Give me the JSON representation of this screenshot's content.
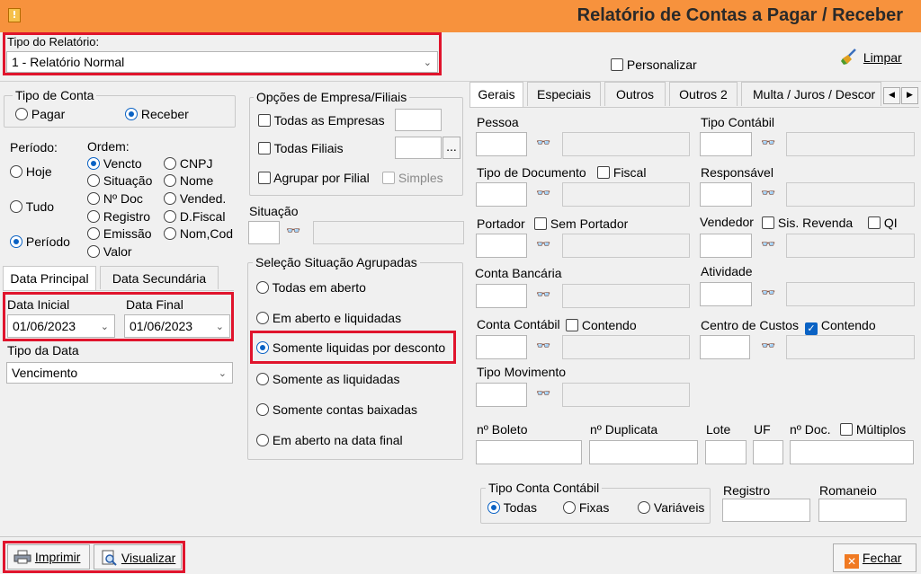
{
  "window": {
    "title": "Relatório de Contas a Pagar / Receber",
    "icon": "warning-app-icon"
  },
  "report_type": {
    "label": "Tipo do Relatório:",
    "value": "1 - Relatório Normal"
  },
  "personalizar": {
    "label": "Personalizar",
    "checked": false
  },
  "limpar": {
    "label": "Limpar",
    "icon": "broom-icon"
  },
  "tipo_conta": {
    "title": "Tipo de Conta",
    "options": [
      "Pagar",
      "Receber"
    ],
    "selected": "Receber"
  },
  "periodo": {
    "title": "Período:",
    "options": [
      "Hoje",
      "Tudo",
      "Período"
    ],
    "selected": "Período"
  },
  "ordem": {
    "title": "Ordem:",
    "options": [
      "Vencto",
      "CNPJ",
      "Situação",
      "Nome",
      "Nº Doc",
      "Vended.",
      "Registro",
      "D.Fiscal",
      "Emissão",
      "Nom,Cod",
      "Valor"
    ],
    "selected": "Vencto"
  },
  "date_tabs": [
    "Data Principal",
    "Data Secundária"
  ],
  "data_inicial": {
    "label": "Data Inicial",
    "value": "01/06/2023"
  },
  "data_final": {
    "label": "Data Final",
    "value": "01/06/2023"
  },
  "tipo_data": {
    "label": "Tipo da Data",
    "value": "Vencimento"
  },
  "empresa": {
    "title": "Opções de Empresa/Filiais",
    "todas_empresas": "Todas as Empresas",
    "todas_filiais": "Todas Filiais",
    "agrupar": "Agrupar por Filial",
    "simples": "Simples",
    "ellipsis": "..."
  },
  "situacao": {
    "label": "Situação"
  },
  "selecao": {
    "title": "Seleção Situação Agrupadas",
    "options": [
      "Todas em aberto",
      "Em aberto e liquidadas",
      "Somente liquidas por desconto",
      "Somente as liquidadas",
      "Somente contas baixadas",
      "Em aberto na data final"
    ],
    "selected": "Somente liquidas por desconto"
  },
  "right_tabs": [
    "Gerais",
    "Especiais",
    "Outros",
    "Outros 2",
    "Multa / Juros / Descor"
  ],
  "fields": {
    "pessoa": "Pessoa",
    "tipo_contabil": "Tipo Contábil",
    "tipo_documento": "Tipo de Documento",
    "fiscal": "Fiscal",
    "responsavel": "Responsável",
    "portador": "Portador",
    "sem_portador": "Sem Portador",
    "vendedor": "Vendedor",
    "sis_revenda": "Sis. Revenda",
    "qi": "QI",
    "conta_bancaria": "Conta Bancária",
    "atividade": "Atividade",
    "conta_contabil": "Conta Contábil",
    "contendo": "Contendo",
    "centro_custos": "Centro de Custos",
    "contendo2": "Contendo",
    "tipo_movimento": "Tipo Movimento",
    "boleto": "nº Boleto",
    "duplicata": "nº Duplicata",
    "lote": "Lote",
    "uf": "UF",
    "ndoc": "nº Doc.",
    "multiplos": "Múltiplos",
    "registro": "Registro",
    "romaneio": "Romaneio"
  },
  "tipo_conta_contabil": {
    "title": "Tipo Conta Contábil",
    "options": [
      "Todas",
      "Fixas",
      "Variáveis"
    ],
    "selected": "Todas"
  },
  "footer": {
    "imprimir": "Imprimir",
    "visualizar": "Visualizar",
    "fechar": "Fechar"
  },
  "colors": {
    "titlebar": "#f7923d",
    "highlight": "#e0142c",
    "accent": "#0a62c4"
  }
}
